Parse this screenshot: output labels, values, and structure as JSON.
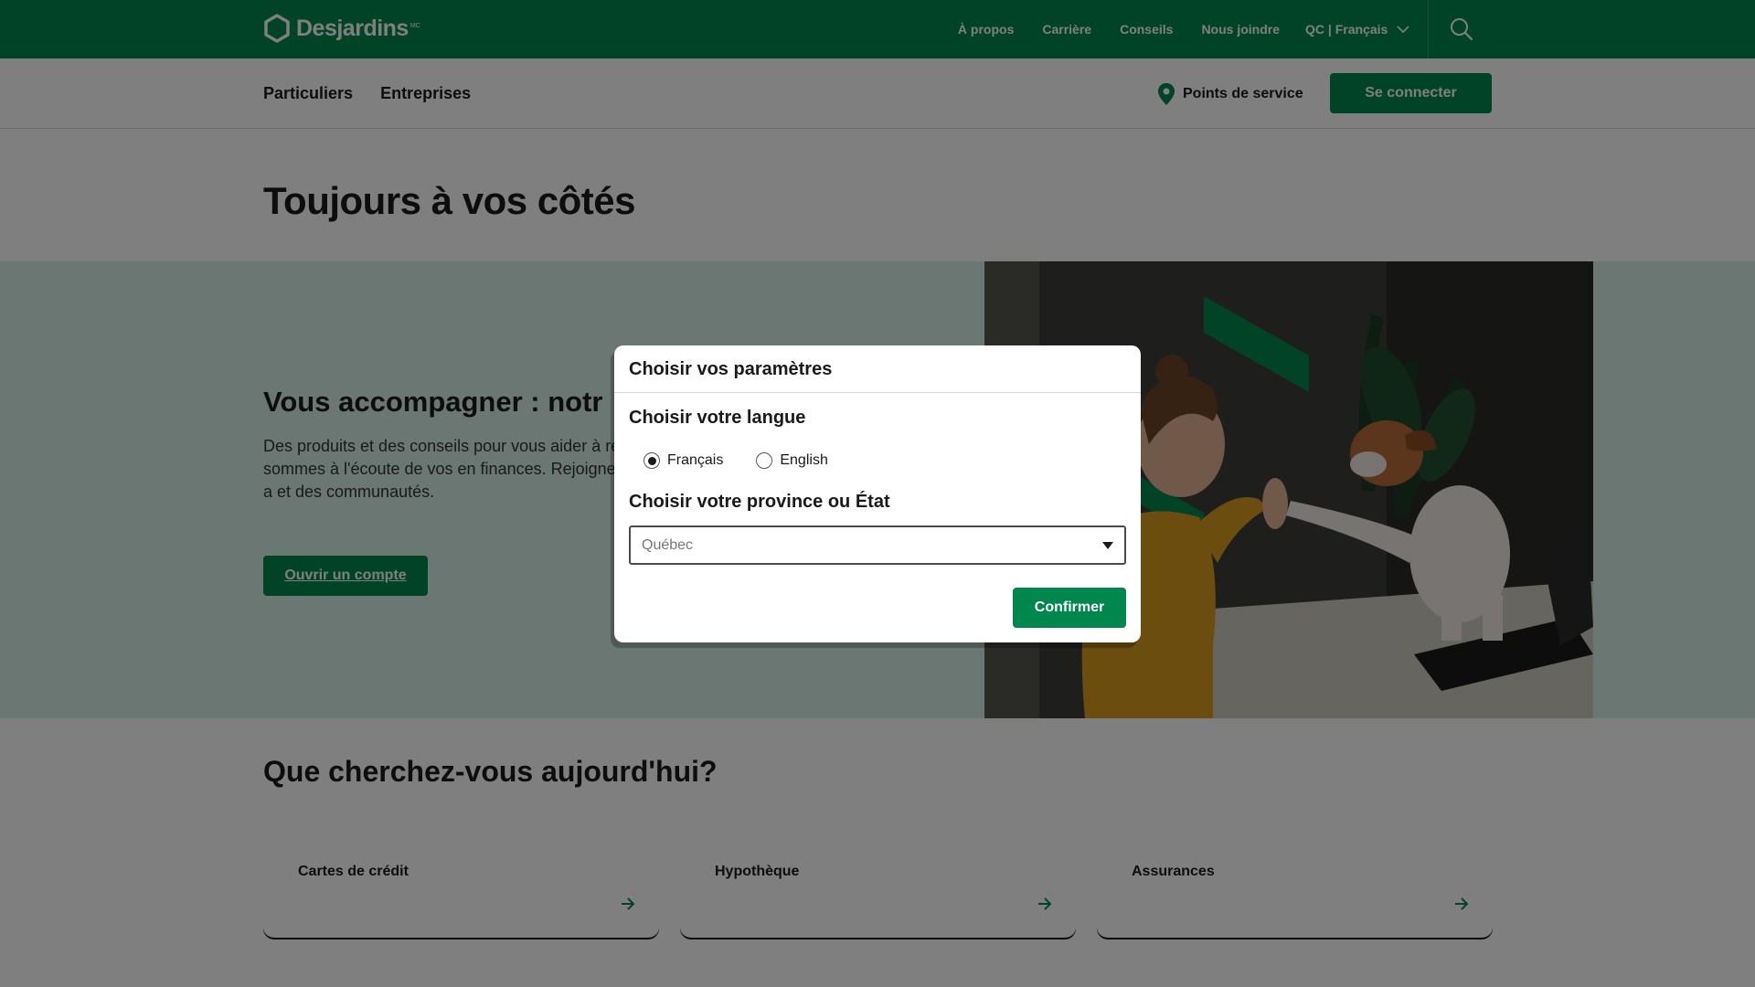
{
  "brand": {
    "logo_text": "Desjardins",
    "logo_mark": "MC"
  },
  "topbar": {
    "links": [
      "À propos",
      "Carrière",
      "Conseils",
      "Nous joindre"
    ],
    "language_switch": "QC | Français",
    "search_icon": "search-icon"
  },
  "subnav": {
    "tabs": [
      "Particuliers",
      "Entreprises"
    ],
    "points_label": "Points de service",
    "connect_label": "Se connecter"
  },
  "page": {
    "title": "Toujours à vos côtés"
  },
  "hero": {
    "heading": "Vous accompagner : notr",
    "body": "Des produits et des conseils pour vous aider à re tiennent à cœur. Nous sommes à l'écoute de vos en finances. Rejoignez une coopérative dédiée a et des communautés.",
    "button": "Ouvrir un compte"
  },
  "search_section": {
    "title": "Que cherchez-vous aujourd'hui?",
    "cards": [
      "Cartes de crédit",
      "Hypothèque",
      "Assurances"
    ]
  },
  "modal": {
    "title": "Choisir vos paramètres",
    "language_heading": "Choisir votre langue",
    "language_options": [
      "Français",
      "English"
    ],
    "language_selected": "Français",
    "province_heading": "Choisir votre province ou État",
    "province_value": "Québec",
    "confirm_label": "Confirmer"
  },
  "colors": {
    "brand_green": "#00874e",
    "hero_bg": "#d7efe4"
  }
}
